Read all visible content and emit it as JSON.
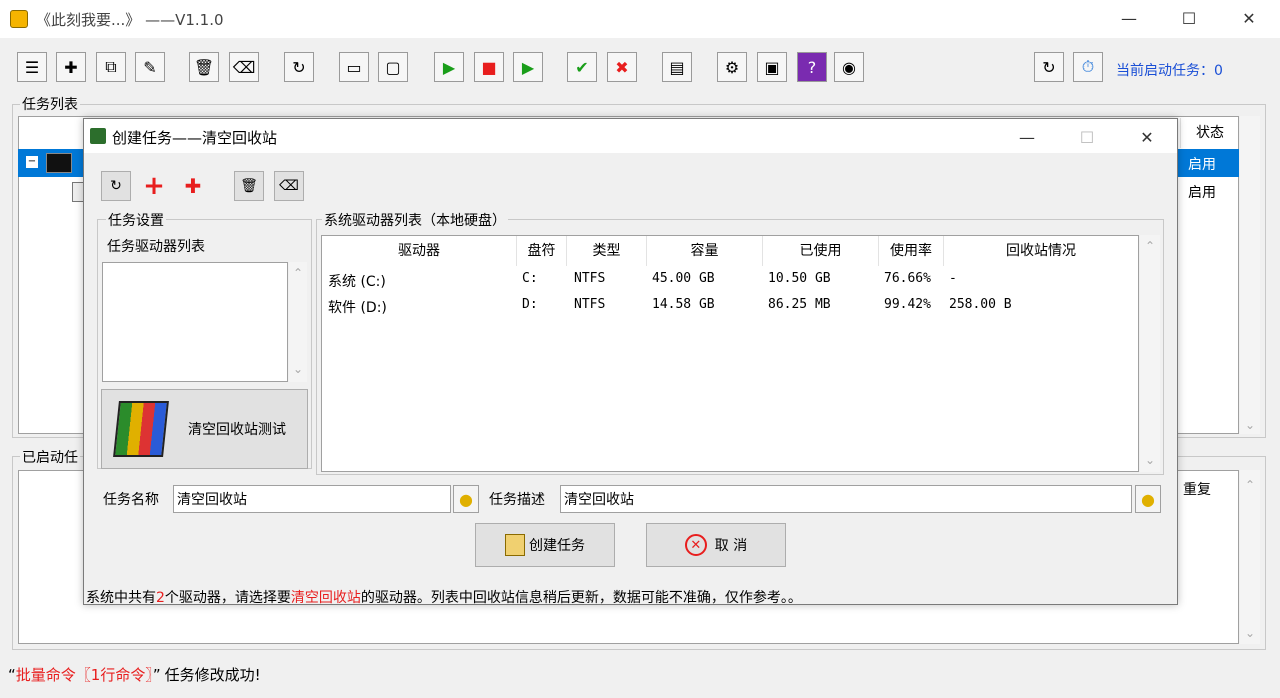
{
  "window": {
    "title": "《此刻我要...》   ——V1.1.0",
    "minimize_label": "—",
    "maximize_label": "☐",
    "close_label": "✕"
  },
  "toolbar": {
    "buttons": [
      {
        "name": "task-list-icon",
        "glyph": "☰"
      },
      {
        "name": "new-task-icon",
        "glyph": "✚"
      },
      {
        "name": "copy-task-icon",
        "glyph": "⧉"
      },
      {
        "name": "edit-task-icon",
        "glyph": "✎"
      },
      {
        "name": "delete-icon",
        "glyph": "🗑"
      },
      {
        "name": "clear-icon",
        "glyph": "⌫"
      },
      {
        "name": "refresh-icon",
        "glyph": "↻"
      },
      {
        "name": "window-minimize-icon",
        "glyph": "▭"
      },
      {
        "name": "window-blank-icon",
        "glyph": "▢"
      },
      {
        "name": "start-icon",
        "glyph": "▶"
      },
      {
        "name": "stop-icon",
        "glyph": "■"
      },
      {
        "name": "resume-icon",
        "glyph": "▶"
      },
      {
        "name": "enable-icon",
        "glyph": "✔"
      },
      {
        "name": "disable-icon",
        "glyph": "✖"
      },
      {
        "name": "notes-icon",
        "glyph": "▤"
      },
      {
        "name": "settings-icon",
        "glyph": "⚙"
      },
      {
        "name": "image-icon",
        "glyph": "▣"
      },
      {
        "name": "help-icon",
        "glyph": "?"
      },
      {
        "name": "about-icon",
        "glyph": "◉"
      }
    ],
    "right_buttons": [
      {
        "name": "reload-icon",
        "glyph": "↻"
      },
      {
        "name": "timer-icon",
        "glyph": "⏱"
      }
    ],
    "active_tasks_label": "当前启动任务：0"
  },
  "task_list": {
    "group_title": "任务列表",
    "status_header": "状态",
    "rows": [
      {
        "status": "启用"
      },
      {
        "status": "启用"
      }
    ]
  },
  "started_tasks": {
    "group_title": "已启动任",
    "repeat_header": "重复"
  },
  "status_bar": {
    "quote_open": "“",
    "highlight": "批量命令〖1行命令〗",
    "quote_close": "”",
    "message": "任务修改成功!"
  },
  "dialog": {
    "title": "创建任务——清空回收站",
    "toolbar_icons": [
      "refresh-icon",
      "add-icon",
      "add-multi-icon",
      "delete-icon",
      "clear-icon"
    ],
    "task_settings": {
      "group_title": "任务设置",
      "drive_list_label": "任务驱动器列表",
      "test_button_label": "清空回收站测试"
    },
    "drive_table": {
      "group_title": "系统驱动器列表（本地硬盘）",
      "columns": [
        "驱动器",
        "盘符",
        "类型",
        "容量",
        "已使用",
        "使用率",
        "回收站情况"
      ],
      "rows": [
        [
          "系统 (C:)",
          "C:",
          "NTFS",
          "45.00 GB",
          "10.50 GB",
          "76.66%",
          "-"
        ],
        [
          "软件 (D:)",
          "D:",
          "NTFS",
          "14.58 GB",
          "86.25 MB",
          "99.42%",
          "258.00 B"
        ]
      ]
    },
    "task_name_label": "任务名称",
    "task_name_value": "清空回收站",
    "task_desc_label": "任务描述",
    "task_desc_value": "清空回收站",
    "create_button_label": "创建任务",
    "cancel_button_label": "取 消",
    "info": {
      "part1": "系统中共有",
      "count": "2",
      "part2": "个驱动器，请选择要",
      "action": "清空回收站",
      "part3": "的驱动器。列表中回收站信息稍后更新，数据可能不准确，仅作参考。。"
    }
  },
  "colors": {
    "selection": "#0078d7",
    "accent_text": "#1a4fd6",
    "highlight_red": "#e81e1e"
  }
}
